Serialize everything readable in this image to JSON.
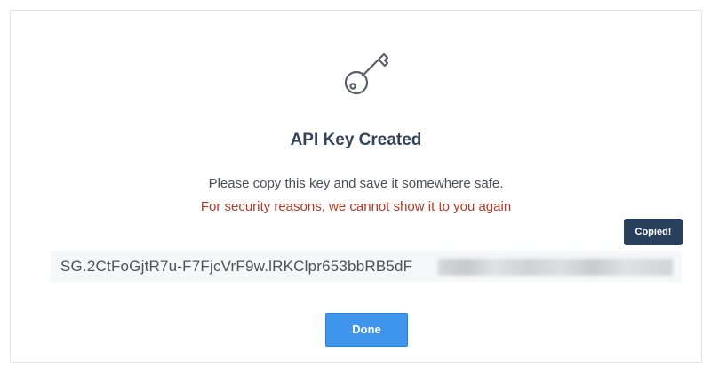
{
  "dialog": {
    "icon": "key-icon",
    "title": "API Key Created",
    "instruction": "Please copy this key and save it somewhere safe.",
    "warning": "For security reasons, we cannot show it to you again",
    "copied_badge": "Copied!",
    "api_key_visible": "SG.2CtFoGjtR7u-F7FjcVrF9w.lRKClpr653bbRB5dF",
    "done_button": "Done"
  },
  "colors": {
    "title": "#34435a",
    "warning": "#b23a26",
    "badge_bg": "#29405d",
    "button_bg": "#3f95ec",
    "key_box_bg": "#f6f7f8"
  }
}
